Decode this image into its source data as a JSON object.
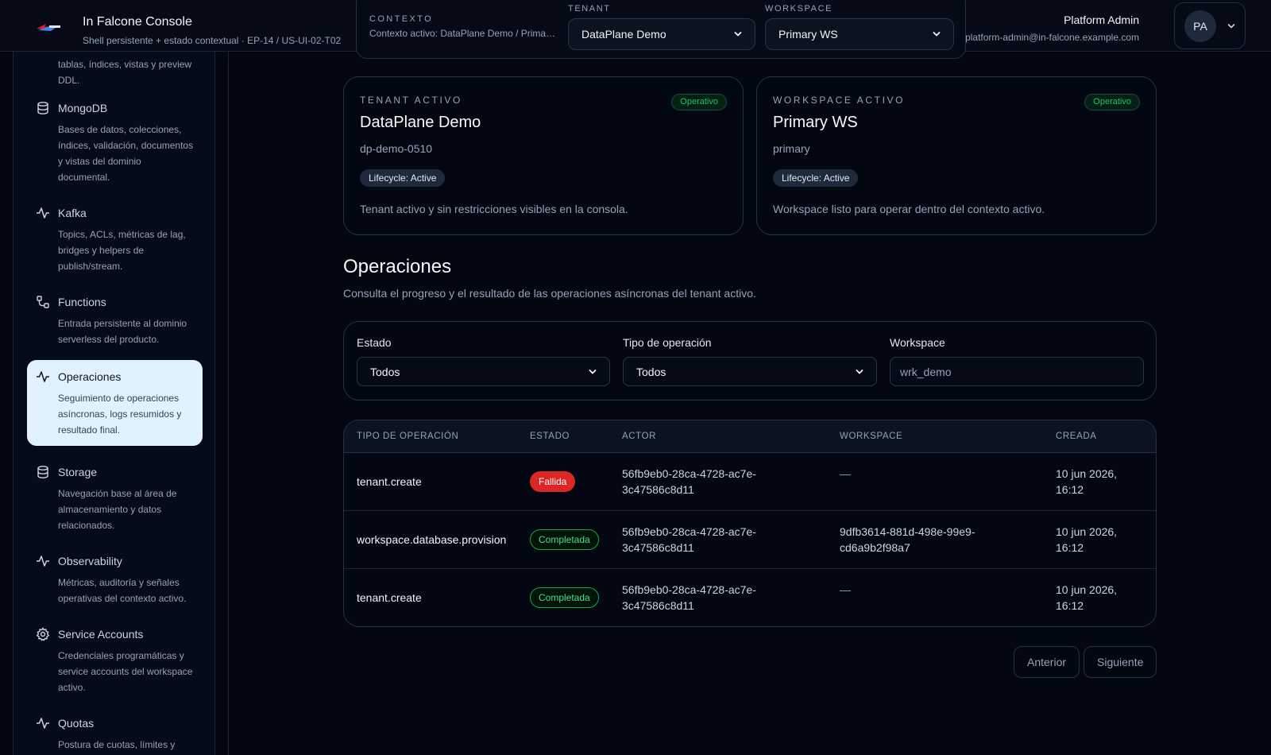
{
  "header": {
    "app_title": "In Falcone Console",
    "app_subtitle": "Shell persistente + estado contextual · EP-14 / US-UI-02-T02",
    "logo_icon": "falcone-logo-icon",
    "context": {
      "label": "CONTEXTO",
      "value": "Contexto activo: DataPlane Demo / Primary WS",
      "tenant_label": "TENANT",
      "tenant_value": "DataPlane Demo",
      "workspace_label": "WORKSPACE",
      "workspace_value": "Primary WS"
    },
    "user": {
      "name": "Platform Admin",
      "email": "platform-admin@in-falcone.example.com",
      "initials": "PA"
    }
  },
  "sidebar": {
    "truncated_desc": "tablas, índices, vistas y preview DDL.",
    "items": [
      {
        "label": "MongoDB",
        "desc": "Bases de datos, colecciones, índices, validación, documentos y vistas del dominio documental.",
        "icon": "database-icon"
      },
      {
        "label": "Kafka",
        "desc": "Topics, ACLs, métricas de lag, bridges y helpers de publish/stream.",
        "icon": "activity-icon"
      },
      {
        "label": "Functions",
        "desc": "Entrada persistente al dominio serverless del producto.",
        "icon": "workflow-icon"
      },
      {
        "label": "Operaciones",
        "desc": "Seguimiento de operaciones asíncronas, logs resumidos y resultado final.",
        "icon": "activity-icon",
        "active": true
      },
      {
        "label": "Storage",
        "desc": "Navegación base al área de almacenamiento y datos relacionados.",
        "icon": "database-icon"
      },
      {
        "label": "Observability",
        "desc": "Métricas, auditoría y señales operativas del contexto activo.",
        "icon": "activity-icon"
      },
      {
        "label": "Service Accounts",
        "desc": "Credenciales programáticas y service accounts del workspace activo.",
        "icon": "gear-icon"
      },
      {
        "label": "Quotas",
        "desc": "Postura de cuotas, límites y consumo por tenant y workspace.",
        "icon": "activity-icon"
      }
    ]
  },
  "tenant_card": {
    "label": "TENANT ACTIVO",
    "badge": "Operativo",
    "title": "DataPlane Demo",
    "slug": "dp-demo-0510",
    "lifecycle": "Lifecycle: Active",
    "desc": "Tenant activo y sin restricciones visibles en la consola."
  },
  "workspace_card": {
    "label": "WORKSPACE ACTIVO",
    "badge": "Operativo",
    "title": "Primary WS",
    "slug": "primary",
    "lifecycle": "Lifecycle: Active",
    "desc": "Workspace listo para operar dentro del contexto activo."
  },
  "operations": {
    "title": "Operaciones",
    "desc": "Consulta el progreso y el resultado de las operaciones asíncronas del tenant activo.",
    "filters": {
      "status_label": "Estado",
      "status_value": "Todos",
      "type_label": "Tipo de operación",
      "type_value": "Todos",
      "workspace_label": "Workspace",
      "workspace_placeholder": "wrk_demo"
    },
    "columns": [
      "TIPO DE OPERACIÓN",
      "ESTADO",
      "ACTOR",
      "WORKSPACE",
      "CREADA"
    ],
    "rows": [
      {
        "type": "tenant.create",
        "status": "Fallida",
        "status_kind": "failed",
        "actor": "56fb9eb0-28ca-4728-ac7e-3c47586c8d11",
        "workspace": "—",
        "created": "10 jun 2026, 16:12"
      },
      {
        "type": "workspace.database.provision",
        "status": "Completada",
        "status_kind": "completed",
        "actor": "56fb9eb0-28ca-4728-ac7e-3c47586c8d11",
        "workspace": "9dfb3614-881d-498e-99e9-cd6a9b2f98a7",
        "created": "10 jun 2026, 16:12"
      },
      {
        "type": "tenant.create",
        "status": "Completada",
        "status_kind": "completed",
        "actor": "56fb9eb0-28ca-4728-ac7e-3c47586c8d11",
        "workspace": "—",
        "created": "10 jun 2026, 16:12"
      }
    ],
    "pager": {
      "prev": "Anterior",
      "next": "Siguiente"
    }
  },
  "colors": {
    "background": "#030712",
    "accent_active": "#e0f2fe",
    "success": "#22c55e",
    "danger": "#dc2626"
  }
}
